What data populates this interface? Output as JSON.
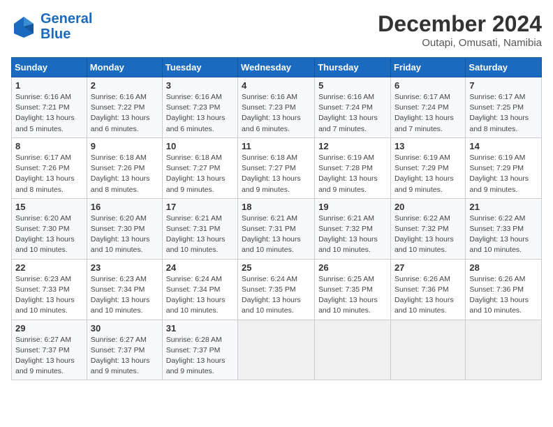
{
  "header": {
    "logo_line1": "General",
    "logo_line2": "Blue",
    "month": "December 2024",
    "location": "Outapi, Omusati, Namibia"
  },
  "days_of_week": [
    "Sunday",
    "Monday",
    "Tuesday",
    "Wednesday",
    "Thursday",
    "Friday",
    "Saturday"
  ],
  "weeks": [
    [
      {
        "day": "1",
        "info": "Sunrise: 6:16 AM\nSunset: 7:21 PM\nDaylight: 13 hours\nand 5 minutes."
      },
      {
        "day": "2",
        "info": "Sunrise: 6:16 AM\nSunset: 7:22 PM\nDaylight: 13 hours\nand 6 minutes."
      },
      {
        "day": "3",
        "info": "Sunrise: 6:16 AM\nSunset: 7:23 PM\nDaylight: 13 hours\nand 6 minutes."
      },
      {
        "day": "4",
        "info": "Sunrise: 6:16 AM\nSunset: 7:23 PM\nDaylight: 13 hours\nand 6 minutes."
      },
      {
        "day": "5",
        "info": "Sunrise: 6:16 AM\nSunset: 7:24 PM\nDaylight: 13 hours\nand 7 minutes."
      },
      {
        "day": "6",
        "info": "Sunrise: 6:17 AM\nSunset: 7:24 PM\nDaylight: 13 hours\nand 7 minutes."
      },
      {
        "day": "7",
        "info": "Sunrise: 6:17 AM\nSunset: 7:25 PM\nDaylight: 13 hours\nand 8 minutes."
      }
    ],
    [
      {
        "day": "8",
        "info": "Sunrise: 6:17 AM\nSunset: 7:26 PM\nDaylight: 13 hours\nand 8 minutes."
      },
      {
        "day": "9",
        "info": "Sunrise: 6:18 AM\nSunset: 7:26 PM\nDaylight: 13 hours\nand 8 minutes."
      },
      {
        "day": "10",
        "info": "Sunrise: 6:18 AM\nSunset: 7:27 PM\nDaylight: 13 hours\nand 9 minutes."
      },
      {
        "day": "11",
        "info": "Sunrise: 6:18 AM\nSunset: 7:27 PM\nDaylight: 13 hours\nand 9 minutes."
      },
      {
        "day": "12",
        "info": "Sunrise: 6:19 AM\nSunset: 7:28 PM\nDaylight: 13 hours\nand 9 minutes."
      },
      {
        "day": "13",
        "info": "Sunrise: 6:19 AM\nSunset: 7:29 PM\nDaylight: 13 hours\nand 9 minutes."
      },
      {
        "day": "14",
        "info": "Sunrise: 6:19 AM\nSunset: 7:29 PM\nDaylight: 13 hours\nand 9 minutes."
      }
    ],
    [
      {
        "day": "15",
        "info": "Sunrise: 6:20 AM\nSunset: 7:30 PM\nDaylight: 13 hours\nand 10 minutes."
      },
      {
        "day": "16",
        "info": "Sunrise: 6:20 AM\nSunset: 7:30 PM\nDaylight: 13 hours\nand 10 minutes."
      },
      {
        "day": "17",
        "info": "Sunrise: 6:21 AM\nSunset: 7:31 PM\nDaylight: 13 hours\nand 10 minutes."
      },
      {
        "day": "18",
        "info": "Sunrise: 6:21 AM\nSunset: 7:31 PM\nDaylight: 13 hours\nand 10 minutes."
      },
      {
        "day": "19",
        "info": "Sunrise: 6:21 AM\nSunset: 7:32 PM\nDaylight: 13 hours\nand 10 minutes."
      },
      {
        "day": "20",
        "info": "Sunrise: 6:22 AM\nSunset: 7:32 PM\nDaylight: 13 hours\nand 10 minutes."
      },
      {
        "day": "21",
        "info": "Sunrise: 6:22 AM\nSunset: 7:33 PM\nDaylight: 13 hours\nand 10 minutes."
      }
    ],
    [
      {
        "day": "22",
        "info": "Sunrise: 6:23 AM\nSunset: 7:33 PM\nDaylight: 13 hours\nand 10 minutes."
      },
      {
        "day": "23",
        "info": "Sunrise: 6:23 AM\nSunset: 7:34 PM\nDaylight: 13 hours\nand 10 minutes."
      },
      {
        "day": "24",
        "info": "Sunrise: 6:24 AM\nSunset: 7:34 PM\nDaylight: 13 hours\nand 10 minutes."
      },
      {
        "day": "25",
        "info": "Sunrise: 6:24 AM\nSunset: 7:35 PM\nDaylight: 13 hours\nand 10 minutes."
      },
      {
        "day": "26",
        "info": "Sunrise: 6:25 AM\nSunset: 7:35 PM\nDaylight: 13 hours\nand 10 minutes."
      },
      {
        "day": "27",
        "info": "Sunrise: 6:26 AM\nSunset: 7:36 PM\nDaylight: 13 hours\nand 10 minutes."
      },
      {
        "day": "28",
        "info": "Sunrise: 6:26 AM\nSunset: 7:36 PM\nDaylight: 13 hours\nand 10 minutes."
      }
    ],
    [
      {
        "day": "29",
        "info": "Sunrise: 6:27 AM\nSunset: 7:37 PM\nDaylight: 13 hours\nand 9 minutes."
      },
      {
        "day": "30",
        "info": "Sunrise: 6:27 AM\nSunset: 7:37 PM\nDaylight: 13 hours\nand 9 minutes."
      },
      {
        "day": "31",
        "info": "Sunrise: 6:28 AM\nSunset: 7:37 PM\nDaylight: 13 hours\nand 9 minutes."
      },
      {
        "day": "",
        "info": ""
      },
      {
        "day": "",
        "info": ""
      },
      {
        "day": "",
        "info": ""
      },
      {
        "day": "",
        "info": ""
      }
    ]
  ]
}
